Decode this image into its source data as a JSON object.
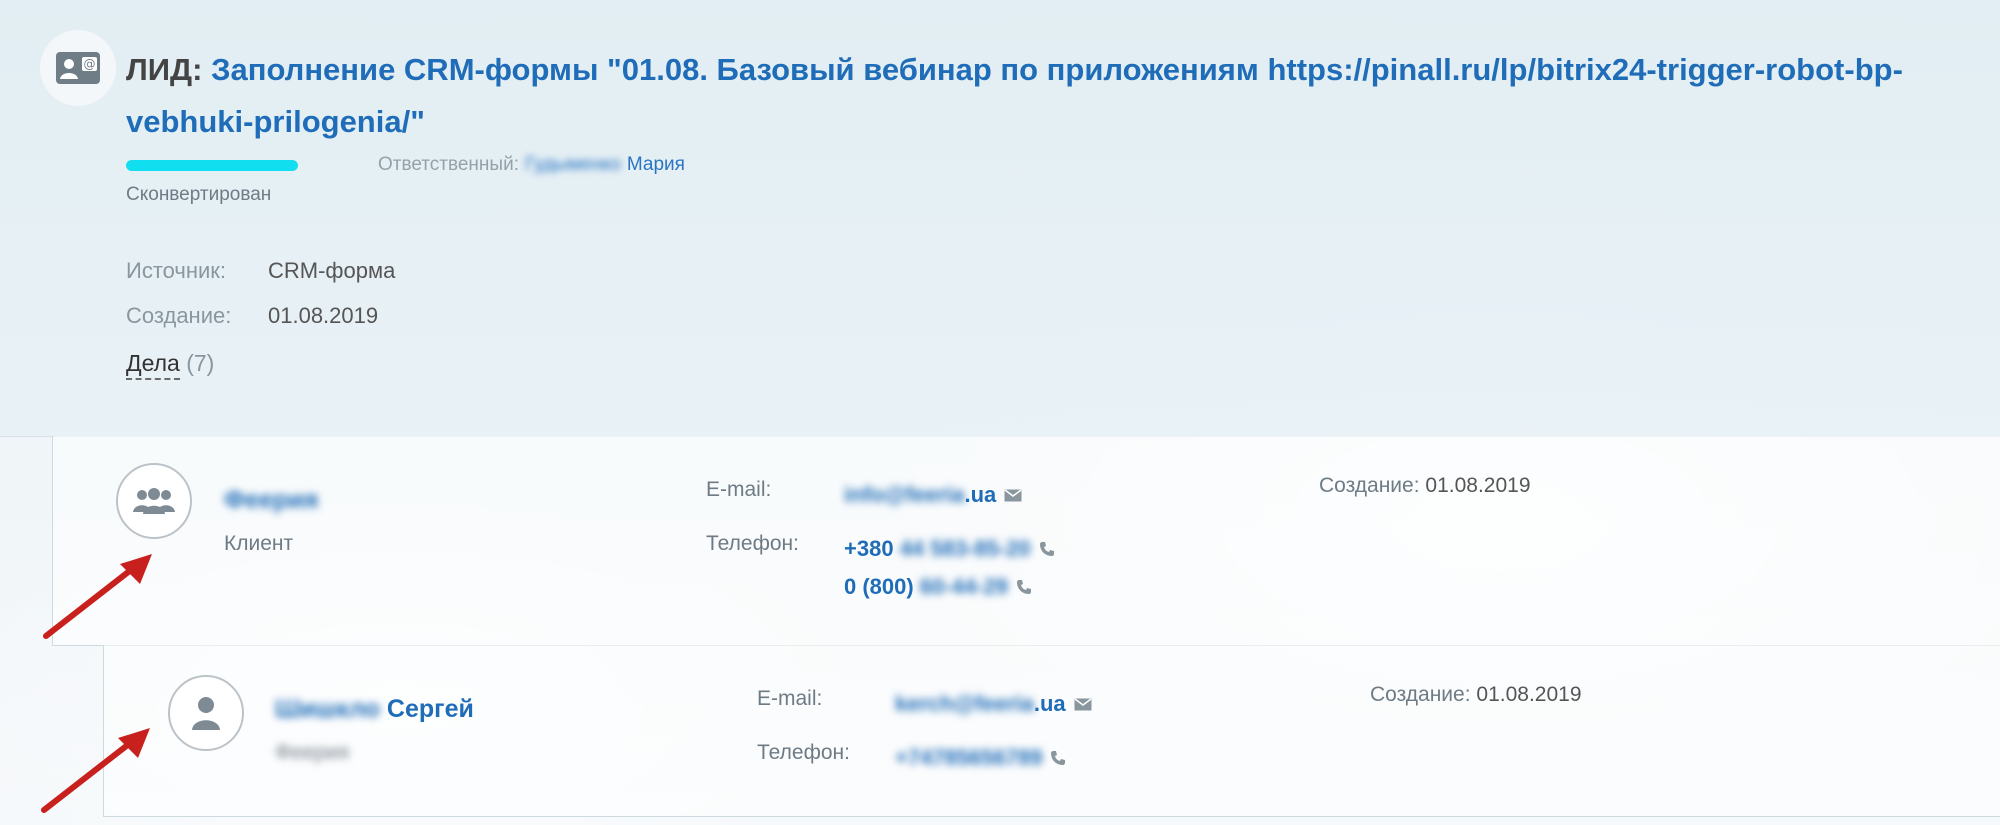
{
  "lead": {
    "prefix": "ЛИД:",
    "title": "Заполнение CRM-формы \"01.08. Базовый вебинар по приложениям https://pinall.ru/lp/bitrix24-trigger-robot-bp-vebhuki-prilogenia/\"",
    "progress": 1.0,
    "status": "Сконвертирован",
    "responsible_label": "Ответственный:",
    "responsible_surname": "Гудыменко",
    "responsible_name": "Мария",
    "source_label": "Источник:",
    "source_value": "CRM-форма",
    "created_label": "Создание:",
    "created_value": "01.08.2019",
    "deals_label": "Дела",
    "deals_count": "(7)"
  },
  "company": {
    "name": "Феерия",
    "type": "Клиент",
    "email_label": "E-mail:",
    "email_hidden": "info@feeria",
    "email_visible": ".ua",
    "phone_label": "Телефон:",
    "phone1_visible": "+380",
    "phone1_hidden": "44 583-85-20",
    "phone2_visible": "0 (800)",
    "phone2_hidden": "60-44-29",
    "created_label": "Создание:",
    "created_value": "01.08.2019"
  },
  "contact": {
    "surname": "Шишкло",
    "name": "Сергей",
    "company": "Феерия",
    "email_label": "E-mail:",
    "email_hidden": "kerch@feeria",
    "email_visible": ".ua",
    "phone_label": "Телефон:",
    "phone_hidden": "+74785656789",
    "created_label": "Создание:",
    "created_value": "01.08.2019"
  },
  "colors": {
    "accent": "#1f6db8",
    "progress": "#11dff0",
    "arrow": "#c8201c"
  },
  "icons": [
    "lead-contact-card-icon",
    "company-group-icon",
    "contact-person-icon",
    "envelope-icon",
    "phone-icon",
    "red-arrow"
  ]
}
